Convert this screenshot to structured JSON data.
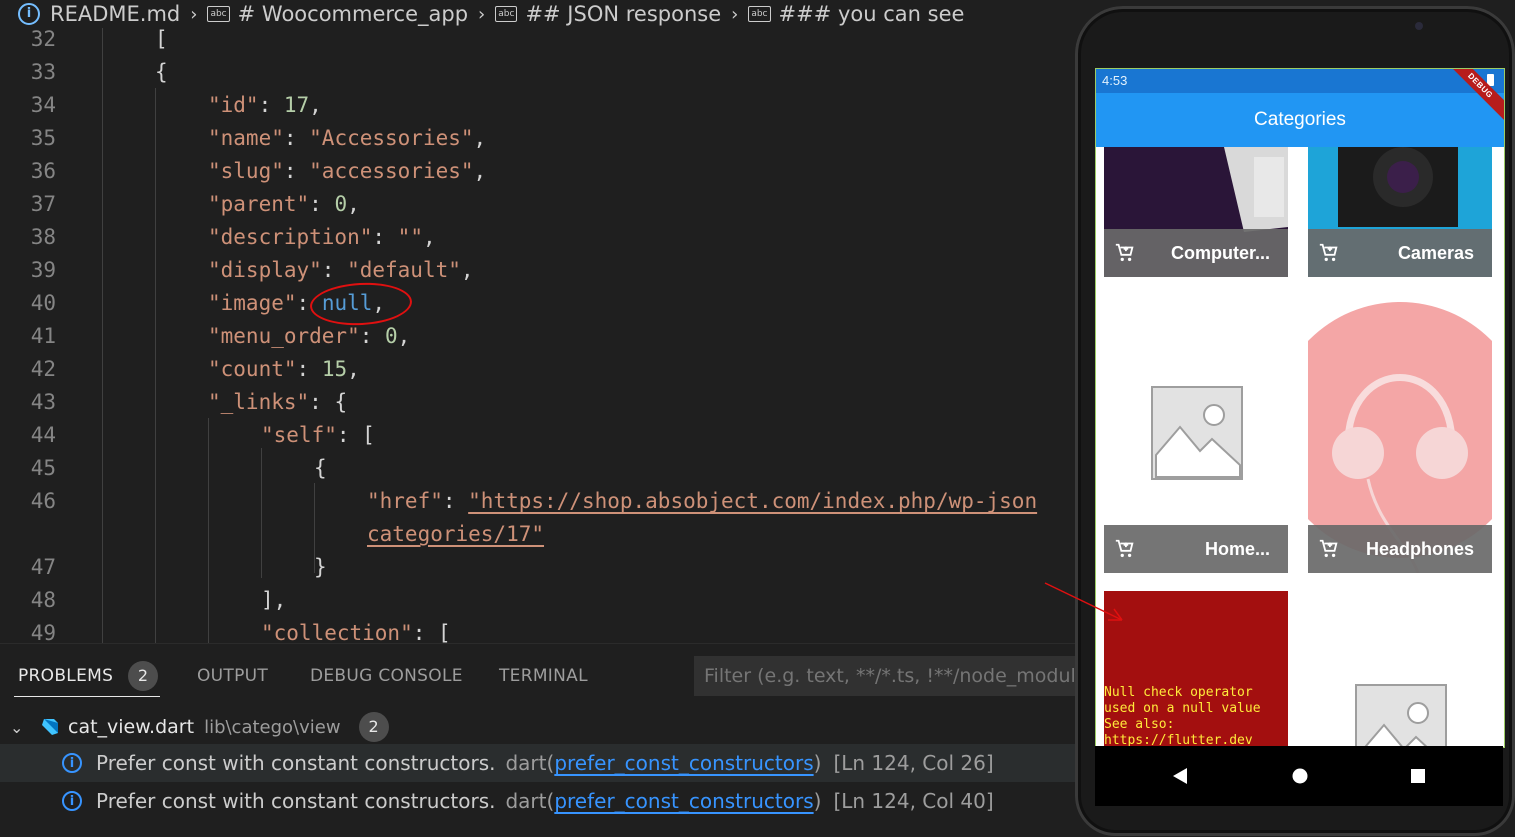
{
  "breadcrumb": {
    "items": [
      "README.md",
      "# Woocommerce_app",
      "## JSON response",
      "### you can see"
    ],
    "abc_icon_text": "abc"
  },
  "editor": {
    "lines": [
      {
        "num": "32",
        "text": "["
      },
      {
        "num": "33",
        "text": "{"
      },
      {
        "num": "34",
        "key": "\"id\"",
        "value": "17",
        "vtype": "num"
      },
      {
        "num": "35",
        "key": "\"name\"",
        "value": "\"Accessories\"",
        "vtype": "str"
      },
      {
        "num": "36",
        "key": "\"slug\"",
        "value": "\"accessories\"",
        "vtype": "str"
      },
      {
        "num": "37",
        "key": "\"parent\"",
        "value": "0",
        "vtype": "num"
      },
      {
        "num": "38",
        "key": "\"description\"",
        "value": "\"\"",
        "vtype": "str"
      },
      {
        "num": "39",
        "key": "\"display\"",
        "value": "\"default\"",
        "vtype": "str"
      },
      {
        "num": "40",
        "key": "\"image\"",
        "value": "null",
        "vtype": "kw"
      },
      {
        "num": "41",
        "key": "\"menu_order\"",
        "value": "0",
        "vtype": "num"
      },
      {
        "num": "42",
        "key": "\"count\"",
        "value": "15",
        "vtype": "num"
      },
      {
        "num": "43",
        "key": "\"_links\"",
        "value": "{",
        "vtype": "punc"
      },
      {
        "num": "44",
        "key": "\"self\"",
        "value": "[",
        "vtype": "punc"
      },
      {
        "num": "45",
        "text": "{"
      },
      {
        "num": "46",
        "key": "\"href\"",
        "value": "\"https://shop.absobject.com/index.php/wp-json",
        "vtype": "url"
      },
      {
        "num": "",
        "text": "categories/17\""
      },
      {
        "num": "47",
        "text": "}"
      },
      {
        "num": "48",
        "text": "],"
      },
      {
        "num": "49",
        "key": "\"collection\"",
        "value": "[",
        "vtype": "punc"
      }
    ]
  },
  "panel": {
    "tabs": [
      "PROBLEMS",
      "OUTPUT",
      "DEBUG CONSOLE",
      "TERMINAL"
    ],
    "problems_count": "2",
    "filter_placeholder": "Filter (e.g. text, **/*.ts, !**/node_modules/**)",
    "file": {
      "name": "cat_view.dart",
      "path": "lib\\catego\\view",
      "count": "2"
    },
    "problems": [
      {
        "message": "Prefer const with constant constructors.",
        "source": "dart(",
        "rule": "prefer_const_constructors",
        "close": ")",
        "location": "[Ln 124, Col 26]"
      },
      {
        "message": "Prefer const with constant constructors.",
        "source": "dart(",
        "rule": "prefer_const_constructors",
        "close": ")",
        "location": "[Ln 124, Col 40]"
      }
    ]
  },
  "phone": {
    "status_time": "4:53",
    "debug_banner": "DEBUG",
    "appbar_title": "Categories",
    "tiles": [
      {
        "label": "Computer..."
      },
      {
        "label": "Cameras"
      },
      {
        "label": "Home..."
      },
      {
        "label": "Headphones"
      }
    ],
    "error_text": "Null check operator\nused on a null value\nSee also:\nhttps://flutter.dev"
  },
  "colors": {
    "editor_bg": "#1f1f1f",
    "json_key": "#ce9178",
    "json_number": "#b5cea8",
    "json_null": "#569cd6",
    "annotation_red": "#e01010",
    "appbar": "#2196f3",
    "error_bg": "#a30f0f"
  }
}
